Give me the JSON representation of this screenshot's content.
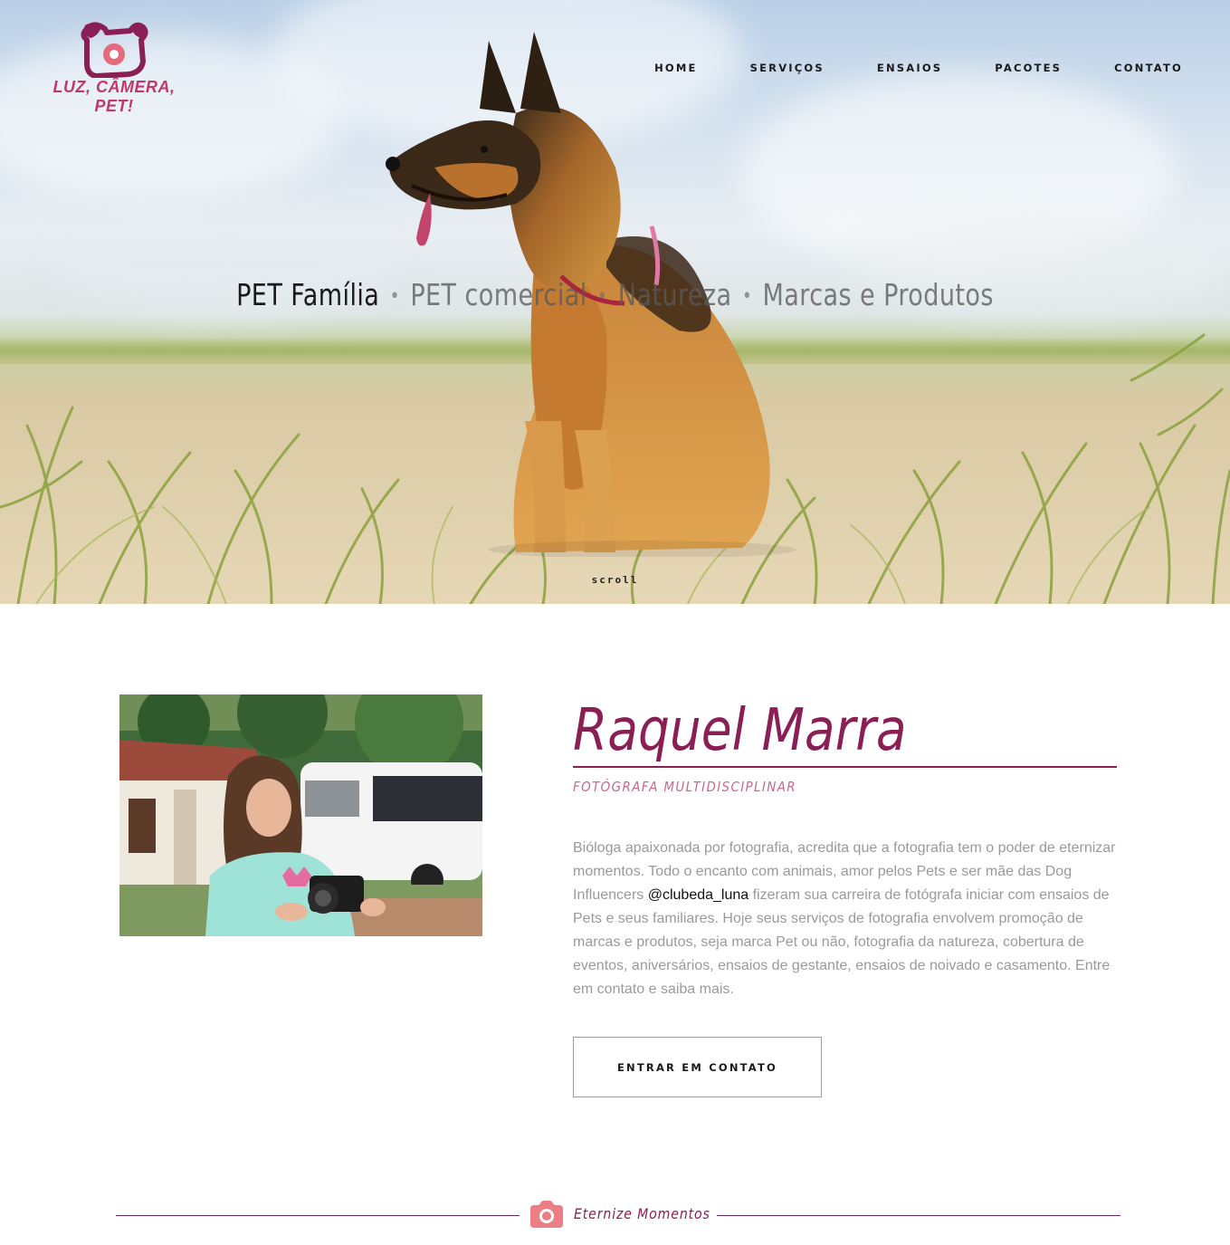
{
  "brand": {
    "logo_text": "LUZ, CÂMERA, PET!",
    "logo_color": "#c0376b"
  },
  "nav": {
    "items": [
      "HOME",
      "SERVIÇOS",
      "ENSAIOS",
      "PACOTES",
      "CONTATO"
    ]
  },
  "hero": {
    "taglines": [
      "PET Família",
      "PET comercial",
      "Natureza",
      "Marcas e Produtos"
    ],
    "separator": "•",
    "active_index": 0,
    "scroll_label": "scroll"
  },
  "about": {
    "name": "Raquel Marra",
    "subtitle": "FOTÓGRAFA MULTIDISCIPLINAR",
    "bio_before": "Bióloga apaixonada por fotografia, acredita que a fotografia tem o poder de eternizar momentos. Todo o encanto com animais, amor pelos Pets e ser mãe das Dog Influencers ",
    "bio_handle": "@clubeda_luna",
    "bio_after": " fizeram sua carreira de fotógrafa iniciar com ensaios de Pets e seus familiares. Hoje seus serviços de fotografia envolvem promoção de marcas e produtos, seja marca Pet ou não, fotografia da natureza, cobertura de eventos, aniversários, ensaios de gestante, ensaios de noivado e casamento. Entre em contato e saiba mais.",
    "cta_label": "ENTRAR EM CONTATO"
  },
  "section_divider": {
    "icon": "camera-icon",
    "text": "Eternize Momentos"
  },
  "colors": {
    "accent": "#8a1f55",
    "accent_light": "#c7698e",
    "body_text": "#9a9a9a"
  }
}
